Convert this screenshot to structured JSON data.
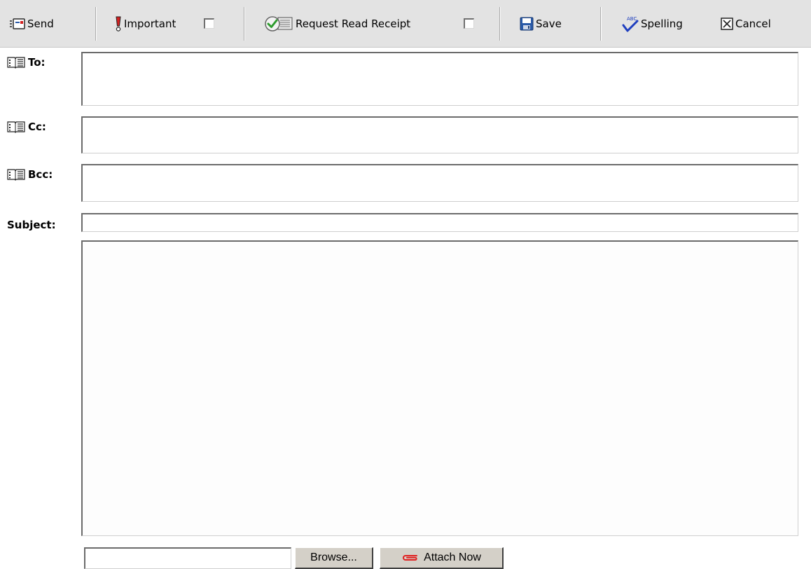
{
  "toolbar": {
    "send_label": "Send",
    "important_label": "Important",
    "read_receipt_label": "Request Read Receipt",
    "save_label": "Save",
    "spelling_label": "Spelling",
    "cancel_label": "Cancel",
    "important_checked": false,
    "read_receipt_checked": false
  },
  "fields": {
    "to_label": "To:",
    "cc_label": "Cc:",
    "bcc_label": "Bcc:",
    "subject_label": "Subject:",
    "to_value": "",
    "cc_value": "",
    "bcc_value": "",
    "subject_value": "",
    "body_value": ""
  },
  "attachments": {
    "file_value": "",
    "browse_label": "Browse...",
    "attach_label": "Attach Now"
  },
  "icons": {
    "send": "send-icon",
    "important": "exclamation-icon",
    "read_receipt": "read-receipt-icon",
    "save": "floppy-disk-icon",
    "spelling": "spellcheck-icon",
    "cancel": "close-box-icon",
    "address_book": "address-book-icon",
    "attach": "paperclip-icon"
  },
  "colors": {
    "toolbar_bg": "#e3e3e3",
    "important_red": "#d42020",
    "check_green": "#2e9c2e",
    "save_blue": "#2a5aa8",
    "spelling_blue": "#1f3fbf",
    "attach_red": "#e02020"
  }
}
